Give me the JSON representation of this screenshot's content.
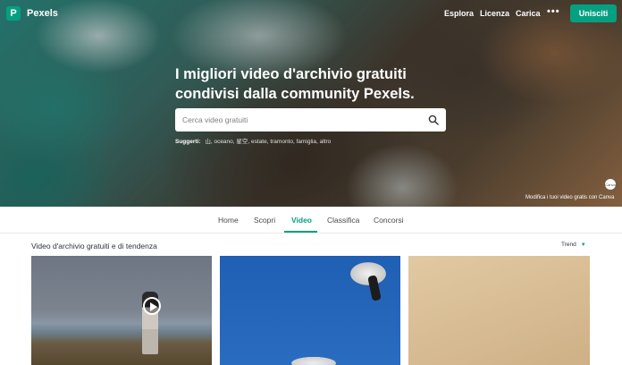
{
  "nav": {
    "logo_letter": "P",
    "brand": "Pexels",
    "links": [
      "Esplora",
      "Licenza",
      "Carica"
    ],
    "more": "•••",
    "join_label": "Unisciti",
    "accent_color": "#05a081"
  },
  "hero": {
    "title_line1": "I migliori video d'archivio gratuiti",
    "title_line2": "condivisi dalla community Pexels.",
    "search_placeholder": "Cerca video gratuiti",
    "suggestions_label": "Suggerti:",
    "suggestions": "山, oceano, 星空, estate, tramonto, famiglia, altro",
    "canva_badge": "Canva",
    "canva_text": "Modifica i tuoi video gratis con Canva"
  },
  "tabs": {
    "items": [
      "Home",
      "Scopri",
      "Video",
      "Classifica",
      "Concorsi"
    ],
    "active": "Video"
  },
  "section": {
    "title": "Video d'archivio gratuiti e di tendenza",
    "sort_label": "Trend"
  },
  "videos": [
    {
      "subject": "woman on beach",
      "has_play_icon": true
    },
    {
      "subject": "seagulls in blue sky",
      "has_play_icon": false
    },
    {
      "subject": "beige texture",
      "has_play_icon": false
    }
  ]
}
